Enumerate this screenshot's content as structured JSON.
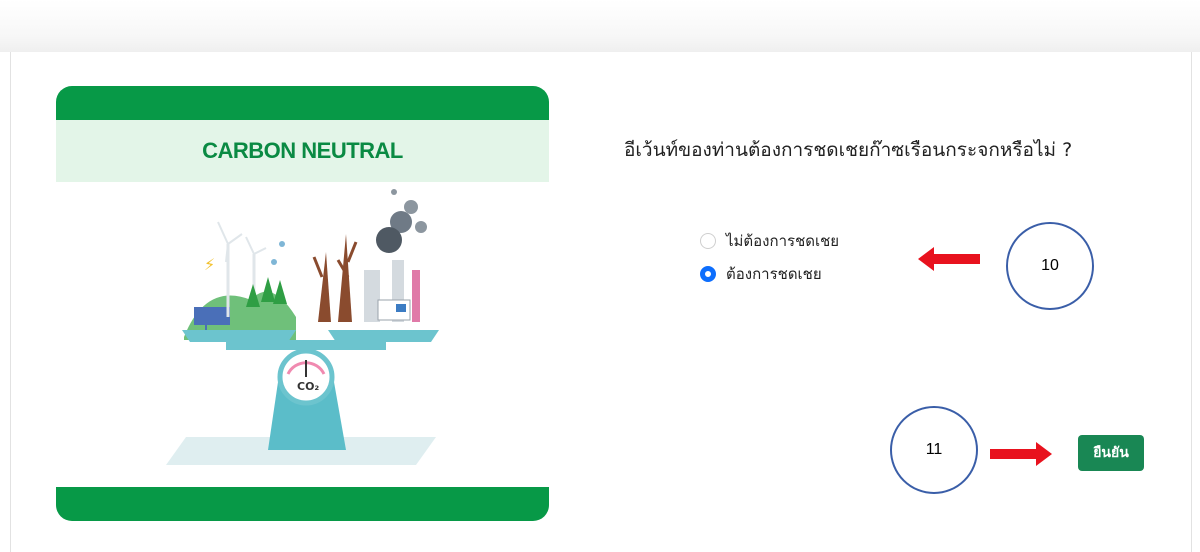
{
  "illustration": {
    "banner_title": "CARBON NEUTRAL",
    "co2_label": "CO₂"
  },
  "form": {
    "question": "อีเว้นท์ของท่านต้องการชดเชยก๊าซเรือนกระจกหรือไม่ ?",
    "options": [
      {
        "label": "ไม่ต้องการชดเชย",
        "selected": false
      },
      {
        "label": "ต้องการชดเชย",
        "selected": true
      }
    ],
    "submit_label": "ยืนยัน"
  },
  "annotations": {
    "step_options": "10",
    "step_submit": "11"
  },
  "colors": {
    "brand_green": "#079947",
    "button_green": "#198754",
    "radio_blue": "#0d6efd",
    "annotation_red": "#e8121e",
    "annotation_circle": "#3a5ea8"
  }
}
